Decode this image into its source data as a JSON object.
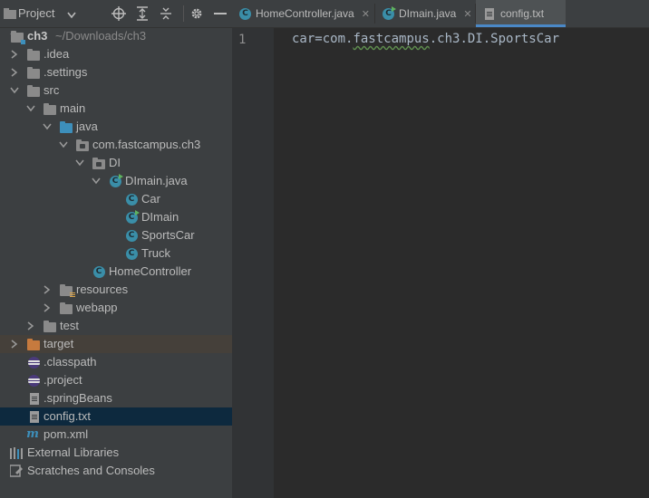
{
  "project_panel": {
    "title": "Project",
    "toolbar_icons": [
      "crosshair-icon",
      "expand-all-icon",
      "collapse-all-icon",
      "gear-icon",
      "minimize-icon"
    ]
  },
  "tree": {
    "root": {
      "label": "ch3",
      "path": "~/Downloads/ch3"
    },
    "idea": ".idea",
    "settings": ".settings",
    "src": "src",
    "main": "main",
    "java": "java",
    "package": "com.fastcampus.ch3",
    "di": "DI",
    "dimain_file": "DImain.java",
    "car": "Car",
    "dimain": "DImain",
    "sportscar": "SportsCar",
    "truck": "Truck",
    "homecontroller": "HomeController",
    "resources": "resources",
    "webapp": "webapp",
    "test": "test",
    "target": "target",
    "classpath": ".classpath",
    "project": ".project",
    "springbeans": ".springBeans",
    "config": "config.txt",
    "pom": "pom.xml",
    "external_libraries": "External Libraries",
    "scratches": "Scratches and Consoles"
  },
  "tabs": [
    {
      "label": "HomeController.java",
      "active": false
    },
    {
      "label": "DImain.java",
      "active": false
    },
    {
      "label": "config.txt",
      "active": true
    }
  ],
  "editor": {
    "line_number": "1",
    "code_prefix": "car=com.",
    "code_typo": "fastcampus",
    "code_suffix": ".ch3.DI.SportsCar"
  },
  "colors": {
    "panel_bg": "#3c3f41",
    "editor_bg": "#2b2b2b",
    "selection": "#0d293e",
    "accent": "#4a88c7",
    "class_icon": "#3a8ea8"
  }
}
